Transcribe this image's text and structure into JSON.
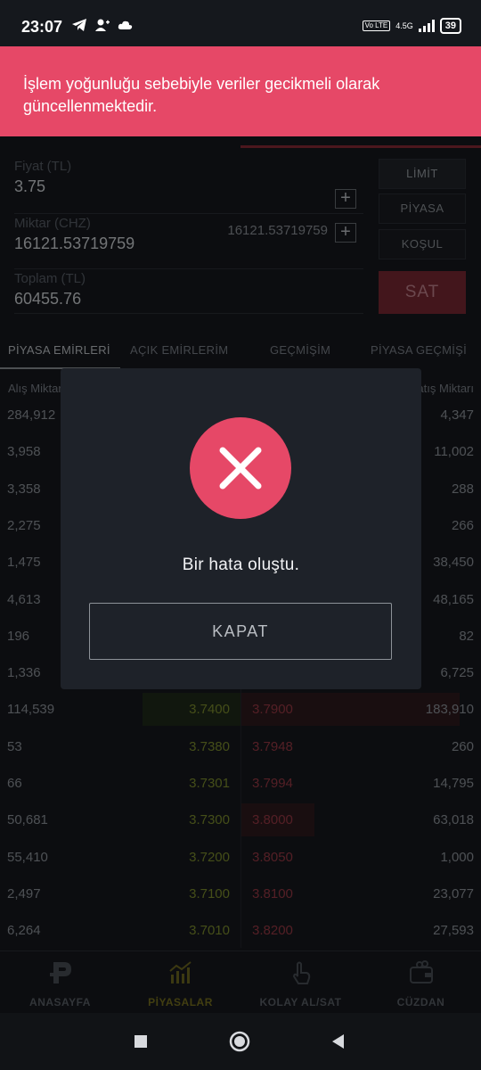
{
  "status_bar": {
    "time": "23:07",
    "network": "4.5G",
    "volte": "Vo LTE",
    "battery": "39"
  },
  "banner": {
    "text": "İşlem yoğunluğu sebebiyle veriler gecikmeli olarak güncellenmektedir."
  },
  "order_form": {
    "price_label": "Fiyat (TL)",
    "price_value": "3.75",
    "amount_label": "Miktar (CHZ)",
    "amount_value": "16121.53719759",
    "amount_available": "16121.53719759",
    "total_label": "Toplam (TL)",
    "total_value": "60455.76",
    "buttons": {
      "limit": "LİMİT",
      "market": "PİYASA",
      "condition": "KOŞUL",
      "sell": "SAT"
    }
  },
  "tabs": [
    "PİYASA EMİRLERİ",
    "AÇIK EMİRLERİM",
    "GEÇMİŞİM",
    "PİYASA GEÇMİŞİ"
  ],
  "orderbook": {
    "bid_header": "Alış Miktarı",
    "ask_header": "Satış Miktarı",
    "rows": [
      {
        "bid_amount": "284,912",
        "bid_price": "",
        "ask_price": "",
        "ask_amount": "4,347"
      },
      {
        "bid_amount": "3,958",
        "bid_price": "",
        "ask_price": "",
        "ask_amount": "11,002"
      },
      {
        "bid_amount": "3,358",
        "bid_price": "",
        "ask_price": "",
        "ask_amount": "288"
      },
      {
        "bid_amount": "2,275",
        "bid_price": "",
        "ask_price": "",
        "ask_amount": "266"
      },
      {
        "bid_amount": "1,475",
        "bid_price": "",
        "ask_price": "",
        "ask_amount": "38,450"
      },
      {
        "bid_amount": "4,613",
        "bid_price": "",
        "ask_price": "",
        "ask_amount": "48,165"
      },
      {
        "bid_amount": "196",
        "bid_price": "",
        "ask_price": "",
        "ask_amount": "82"
      },
      {
        "bid_amount": "1,336",
        "bid_price": "",
        "ask_price": "",
        "ask_amount": "6,725"
      },
      {
        "bid_amount": "114,539",
        "bid_price": "3.7400",
        "ask_price": "3.7900",
        "ask_amount": "183,910"
      },
      {
        "bid_amount": "53",
        "bid_price": "3.7380",
        "ask_price": "3.7948",
        "ask_amount": "260"
      },
      {
        "bid_amount": "66",
        "bid_price": "3.7301",
        "ask_price": "3.7994",
        "ask_amount": "14,795"
      },
      {
        "bid_amount": "50,681",
        "bid_price": "3.7300",
        "ask_price": "3.8000",
        "ask_amount": "63,018"
      },
      {
        "bid_amount": "55,410",
        "bid_price": "3.7200",
        "ask_price": "3.8050",
        "ask_amount": "1,000"
      },
      {
        "bid_amount": "2,497",
        "bid_price": "3.7100",
        "ask_price": "3.8100",
        "ask_amount": "23,077"
      },
      {
        "bid_amount": "6,264",
        "bid_price": "3.7010",
        "ask_price": "3.8200",
        "ask_amount": "27,593"
      }
    ]
  },
  "bottom_nav": [
    "ANASAYFA",
    "PİYASALAR",
    "KOLAY AL/SAT",
    "CÜZDAN"
  ],
  "modal": {
    "message": "Bir hata oluştu.",
    "close_label": "KAPAT"
  },
  "colors": {
    "accent_red": "#e64867",
    "background": "#15181d",
    "modal_bg": "#1e2229"
  }
}
